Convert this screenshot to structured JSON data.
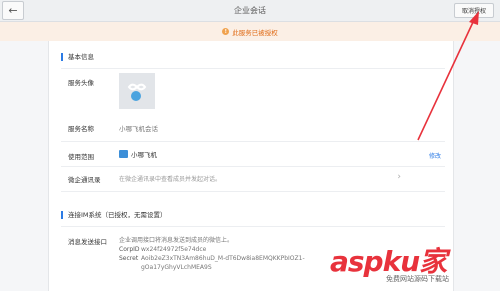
{
  "header": {
    "title": "企业会话",
    "back_glyph": "←",
    "revoke_label": "取消授权"
  },
  "notice": {
    "icon": "!",
    "text": "此服务已被授权"
  },
  "basic": {
    "section_title": "基本信息",
    "avatar_label": "服务头像",
    "name_label": "服务名称",
    "name_value": "小哪飞机会话",
    "scope_label": "使用范围",
    "scope_value": "小哪飞机",
    "edit_label": "修改",
    "contacts_label": "微企通讯录",
    "contacts_hint": "在微企通讯录中查看成员并发起对话。",
    "chevron_glyph": "›"
  },
  "im": {
    "section_title": "连接IM系统（已授权，无需设置）",
    "api_label": "消息发送接口",
    "api_desc": "企业调用接口将消息发送到成员的微信上。",
    "corp_key": "CorpID",
    "corp_value": "wx24f24972f5e74dce",
    "secret_key": "Secret",
    "secret_value_1": "Aoib2eZ3xTN3Am86huD_M-dT6Dw8ia8EMQKKPbIOZ1-",
    "secret_value_2": "gOa17yGhyVLchMEA9S"
  },
  "watermark": {
    "main": "aspku家",
    "sub": "免费网站源码下载站"
  },
  "colors": {
    "accent_blue": "#2c7be5",
    "notice_orange": "#e06b16",
    "arrow_red": "#e8323c"
  }
}
